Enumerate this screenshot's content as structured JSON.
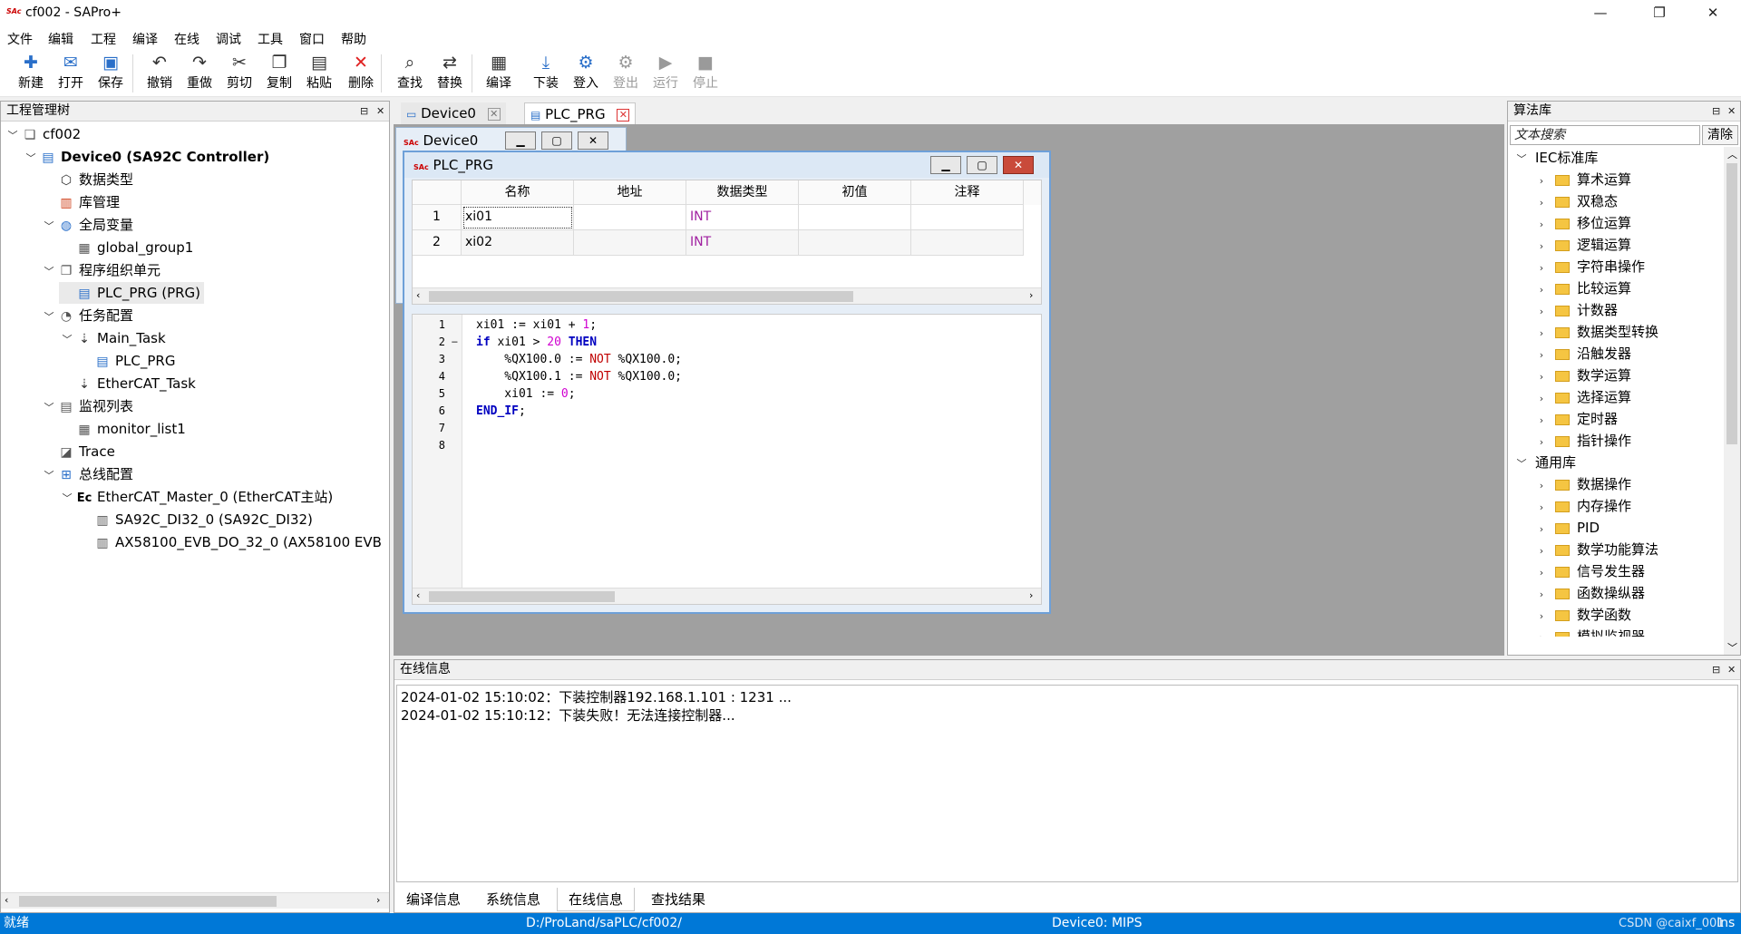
{
  "window": {
    "title": "cf002 - SAPro+",
    "app_icon": "SAc",
    "min_icon": "minimize-icon",
    "max_icon": "maximize-icon",
    "close_icon": "close-icon"
  },
  "menu": [
    "文件",
    "编辑",
    "工程",
    "编译",
    "在线",
    "调试",
    "工具",
    "窗口",
    "帮助"
  ],
  "toolbar": [
    {
      "label": "新建",
      "icon": "new-file-icon",
      "glyph": "✚",
      "enabled": true
    },
    {
      "label": "打开",
      "icon": "open-icon",
      "glyph": "✉",
      "enabled": true
    },
    {
      "label": "保存",
      "icon": "save-icon",
      "glyph": "▣",
      "enabled": true
    },
    {
      "label": "撤销",
      "icon": "undo-icon",
      "glyph": "↶",
      "enabled": true
    },
    {
      "label": "重做",
      "icon": "redo-icon",
      "glyph": "↷",
      "enabled": true
    },
    {
      "label": "剪切",
      "icon": "cut-icon",
      "glyph": "✂",
      "enabled": true
    },
    {
      "label": "复制",
      "icon": "copy-icon",
      "glyph": "❐",
      "enabled": true
    },
    {
      "label": "粘贴",
      "icon": "paste-icon",
      "glyph": "▤",
      "enabled": true
    },
    {
      "label": "删除",
      "icon": "delete-icon",
      "glyph": "✕",
      "enabled": true
    },
    {
      "label": "查找",
      "icon": "find-icon",
      "glyph": "⌕",
      "enabled": true
    },
    {
      "label": "替换",
      "icon": "replace-icon",
      "glyph": "⇄",
      "enabled": true
    },
    {
      "label": "编译",
      "icon": "compile-icon",
      "glyph": "▦",
      "enabled": true
    },
    {
      "label": "下装",
      "icon": "download-icon",
      "glyph": "⤓",
      "enabled": true
    },
    {
      "label": "登入",
      "icon": "login-icon",
      "glyph": "⚙",
      "enabled": true
    },
    {
      "label": "登出",
      "icon": "logout-icon",
      "glyph": "⚙",
      "enabled": false
    },
    {
      "label": "运行",
      "icon": "run-icon",
      "glyph": "▶",
      "enabled": false
    },
    {
      "label": "停止",
      "icon": "stop-icon",
      "glyph": "■",
      "enabled": false
    }
  ],
  "project_tree": {
    "title": "工程管理树",
    "items": [
      {
        "label": "cf002",
        "icon": "project-icon",
        "glyph": "❏",
        "level": 0,
        "twisty": "v",
        "bold": false
      },
      {
        "label": "Device0 (SA92C Controller)",
        "icon": "device-icon",
        "glyph": "▤",
        "level": 1,
        "twisty": "v",
        "bold": true
      },
      {
        "label": "数据类型",
        "icon": "datatype-icon",
        "glyph": "⬡",
        "level": 2,
        "twisty": "",
        "bold": false
      },
      {
        "label": "库管理",
        "icon": "library-icon",
        "glyph": "▥",
        "level": 2,
        "twisty": "",
        "bold": false
      },
      {
        "label": "全局变量",
        "icon": "globe-icon",
        "glyph": "◍",
        "level": 2,
        "twisty": "v",
        "bold": false
      },
      {
        "label": "global_group1",
        "icon": "table-icon",
        "glyph": "▦",
        "level": 3,
        "twisty": "",
        "bold": false
      },
      {
        "label": "程序组织单元",
        "icon": "pou-icon",
        "glyph": "❐",
        "level": 2,
        "twisty": "v",
        "bold": false
      },
      {
        "label": "PLC_PRG (PRG)",
        "icon": "program-icon",
        "glyph": "▤",
        "level": 3,
        "twisty": "",
        "bold": false,
        "selected": true
      },
      {
        "label": "任务配置",
        "icon": "task-config-icon",
        "glyph": "◔",
        "level": 2,
        "twisty": "v",
        "bold": false
      },
      {
        "label": "Main_Task",
        "icon": "task-icon",
        "glyph": "⇣",
        "level": 3,
        "twisty": "v",
        "bold": false
      },
      {
        "label": "PLC_PRG",
        "icon": "program-icon",
        "glyph": "▤",
        "level": 4,
        "twisty": "",
        "bold": false
      },
      {
        "label": "EtherCAT_Task",
        "icon": "task-icon",
        "glyph": "⇣",
        "level": 3,
        "twisty": "",
        "bold": false
      },
      {
        "label": "监视列表",
        "icon": "watch-list-icon",
        "glyph": "▤",
        "level": 2,
        "twisty": "v",
        "bold": false
      },
      {
        "label": "monitor_list1",
        "icon": "table-icon",
        "glyph": "▦",
        "level": 3,
        "twisty": "",
        "bold": false
      },
      {
        "label": "Trace",
        "icon": "trace-icon",
        "glyph": "◪",
        "level": 2,
        "twisty": "",
        "bold": false
      },
      {
        "label": "总线配置",
        "icon": "bus-icon",
        "glyph": "⊞",
        "level": 2,
        "twisty": "v",
        "bold": false
      },
      {
        "label": "EtherCAT_Master_0 (EtherCAT主站)",
        "icon": "ethercat-icon",
        "glyph": "Ec",
        "level": 3,
        "twisty": "v",
        "bold": false
      },
      {
        "label": "SA92C_DI32_0 (SA92C_DI32)",
        "icon": "slave-icon",
        "glyph": "▥",
        "level": 4,
        "twisty": "",
        "bold": false
      },
      {
        "label": "AX58100_EVB_DO_32_0 (AX58100 EVB",
        "icon": "slave-icon",
        "glyph": "▥",
        "level": 4,
        "twisty": "",
        "bold": false
      }
    ]
  },
  "doc_tabs": [
    {
      "label": "Device0",
      "active": false
    },
    {
      "label": "PLC_PRG",
      "active": true
    }
  ],
  "device_window": {
    "title": "Device0"
  },
  "prg_window": {
    "title": "PLC_PRG",
    "columns": [
      "名称",
      "地址",
      "数据类型",
      "初值",
      "注释"
    ],
    "rows": [
      {
        "idx": "1",
        "name": "xi01",
        "addr": "",
        "type": "INT",
        "init": "",
        "comment": ""
      },
      {
        "idx": "2",
        "name": "xi02",
        "addr": "",
        "type": "INT",
        "init": "",
        "comment": ""
      }
    ],
    "line_numbers": [
      "1",
      "2",
      "3",
      "4",
      "5",
      "6",
      "7",
      "8"
    ],
    "code": [
      [
        {
          "t": "xi01 := xi01 + ",
          "c": "#000"
        },
        {
          "t": "1",
          "c": "#d000d0"
        },
        {
          "t": ";",
          "c": "#000"
        }
      ],
      [
        {
          "t": "if",
          "c": "#0000c0",
          "b": true
        },
        {
          "t": " xi01 > ",
          "c": "#000"
        },
        {
          "t": "20",
          "c": "#d000d0"
        },
        {
          "t": " ",
          "c": "#000"
        },
        {
          "t": "THEN",
          "c": "#0000c0",
          "b": true
        }
      ],
      [
        {
          "t": "    %QX100.0 := ",
          "c": "#000"
        },
        {
          "t": "NOT",
          "c": "#c00000"
        },
        {
          "t": " %QX100.0;",
          "c": "#000"
        }
      ],
      [
        {
          "t": "    %QX100.1 := ",
          "c": "#000"
        },
        {
          "t": "NOT",
          "c": "#c00000"
        },
        {
          "t": " %QX100.0;",
          "c": "#000"
        }
      ],
      [
        {
          "t": "    xi01 := ",
          "c": "#000"
        },
        {
          "t": "0",
          "c": "#d000d0"
        },
        {
          "t": ";",
          "c": "#000"
        }
      ],
      [
        {
          "t": "END_IF",
          "c": "#0000c0",
          "b": true
        },
        {
          "t": ";",
          "c": "#000"
        }
      ],
      [],
      []
    ]
  },
  "algo_lib": {
    "title": "算法库",
    "search_placeholder": "文本搜索",
    "clear_label": "清除",
    "groups": [
      {
        "label": "IEC标准库",
        "items": [
          "算术运算",
          "双稳态",
          "移位运算",
          "逻辑运算",
          "字符串操作",
          "比较运算",
          "计数器",
          "数据类型转换",
          "沿触发器",
          "数学运算",
          "选择运算",
          "定时器",
          "指针操作"
        ]
      },
      {
        "label": "通用库",
        "items": [
          "数据操作",
          "内存操作",
          "PID",
          "数学功能算法",
          "信号发生器",
          "函数操纵器",
          "数学函数",
          "模拟监视器"
        ]
      }
    ]
  },
  "online_info": {
    "title": "在线信息",
    "lines": [
      "2024-01-02 15:10:02：下装控制器192.168.1.101 : 1231 ...",
      "2024-01-02 15:10:12：下装失败！无法连接控制器..."
    ],
    "tabs": [
      "编译信息",
      "系统信息",
      "在线信息",
      "查找结果"
    ],
    "active_tab": 2
  },
  "status": {
    "left": "就绪",
    "path": "D:/ProLand/saPLC/cf002/",
    "device": "Device0: MIPS",
    "mode": "Ins",
    "watermark": "CSDN @caixf_001"
  }
}
